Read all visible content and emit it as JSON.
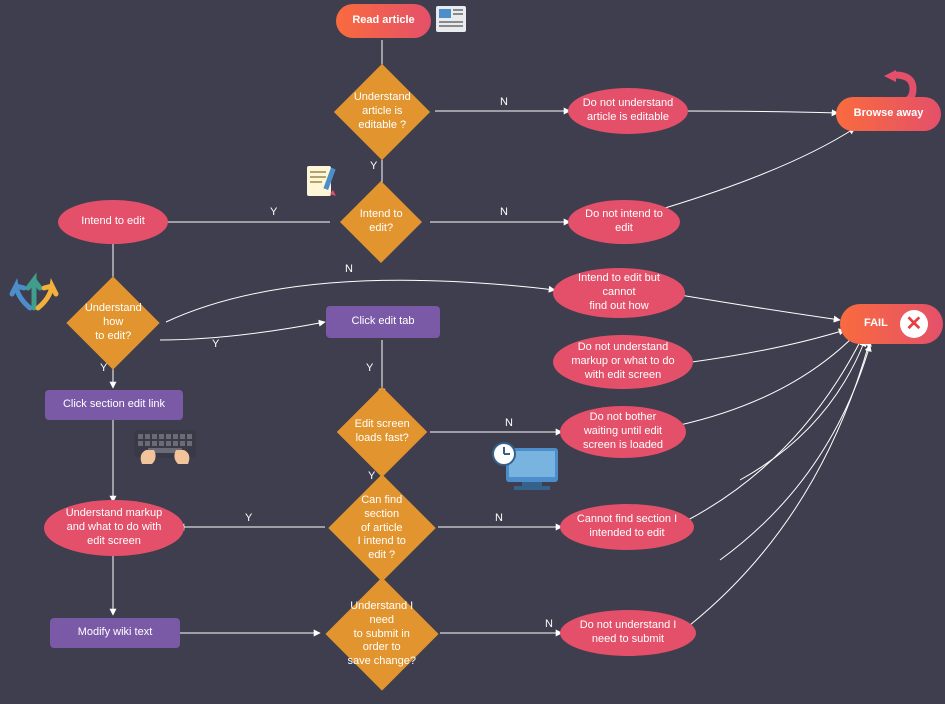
{
  "nodes": {
    "read_article": "Read article",
    "understand_editable": "Understand\narticle is editable ?",
    "not_understand_editable": "Do not understand\narticle is editable",
    "browse_away": "Browse away",
    "intend_to_edit_decision": "Intend to edit?",
    "intend_to_edit": "Intend to edit",
    "do_not_intend": "Do not intend to\nedit",
    "understand_how": "Understand how\nto edit?",
    "click_edit_tab": "Click edit tab",
    "intend_cannot_find": "Intend to edit but\ncannot\nfind out how",
    "fail": "FAIL",
    "click_section_link": "Click section edit link",
    "not_understand_markup_top": "Do not understand\nmarkup or what to do\nwith edit screen",
    "edit_screen_loads": "Edit screen\nloads fast?",
    "not_bother_waiting": "Do not bother\nwaiting until edit\nscreen is loaded",
    "can_find_section": "Can find section\nof article\nI intend to edit ?",
    "cannot_find_section": "Cannot find section I\nintended to edit",
    "understand_markup": "Understand markup\nand what to do with\nedit screen",
    "modify_wiki": "Modify wiki text",
    "understand_submit": "Understand I need\nto submit  in order to\nsave change?",
    "not_understand_submit": "Do not understand I\nneed to submit"
  },
  "edge_labels": {
    "y": "Y",
    "n": "N"
  },
  "colors": {
    "terminator_start": "#f96b3e",
    "terminator_end": "#e4506a",
    "decision": "#e2952f",
    "ellipse": "#e4506a",
    "process": "#7a5aa7",
    "arrow": "#ffffff"
  }
}
